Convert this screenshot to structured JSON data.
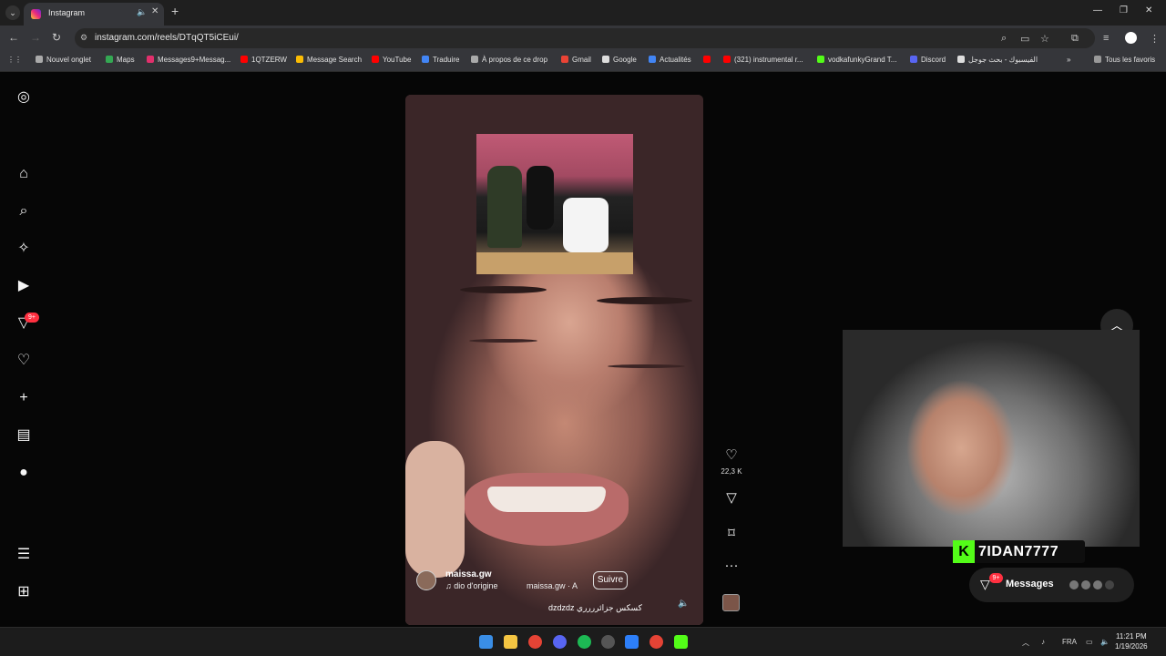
{
  "browser": {
    "tab_title": "Instagram",
    "url": "instagram.com/reels/DTqQT5iCEui/",
    "bookmarks": [
      "Nouvel onglet",
      "Maps",
      "Messages9+Messag...",
      "1QTZERW",
      "Message Search",
      "YouTube",
      "Traduire",
      "À propos de ce drop",
      "Gmail",
      "Google",
      "Actualités",
      "",
      "(321) instrumental r...",
      "vodkafunkyGrand T...",
      "Discord",
      "الفيسبوك - بحث جوجل"
    ],
    "all_bookmarks": "Tous les favoris"
  },
  "sidebar": {
    "notification_badge": "9+"
  },
  "reel": {
    "username": "maissa.gw",
    "follow_label": "Suivre",
    "audio_label": "dio d'origine",
    "audio_owner": "maissa.gw · A",
    "caption": "dzdzdz كسكس جزائرررري",
    "likes": "22,3 K"
  },
  "stream": {
    "streamer_name": "7IDAN7777",
    "k_logo": "K"
  },
  "messages": {
    "label": "Messages",
    "badge": "9+"
  },
  "taskbar": {
    "language": "FRA",
    "time": "11:21 PM",
    "date": "1/19/2026"
  }
}
